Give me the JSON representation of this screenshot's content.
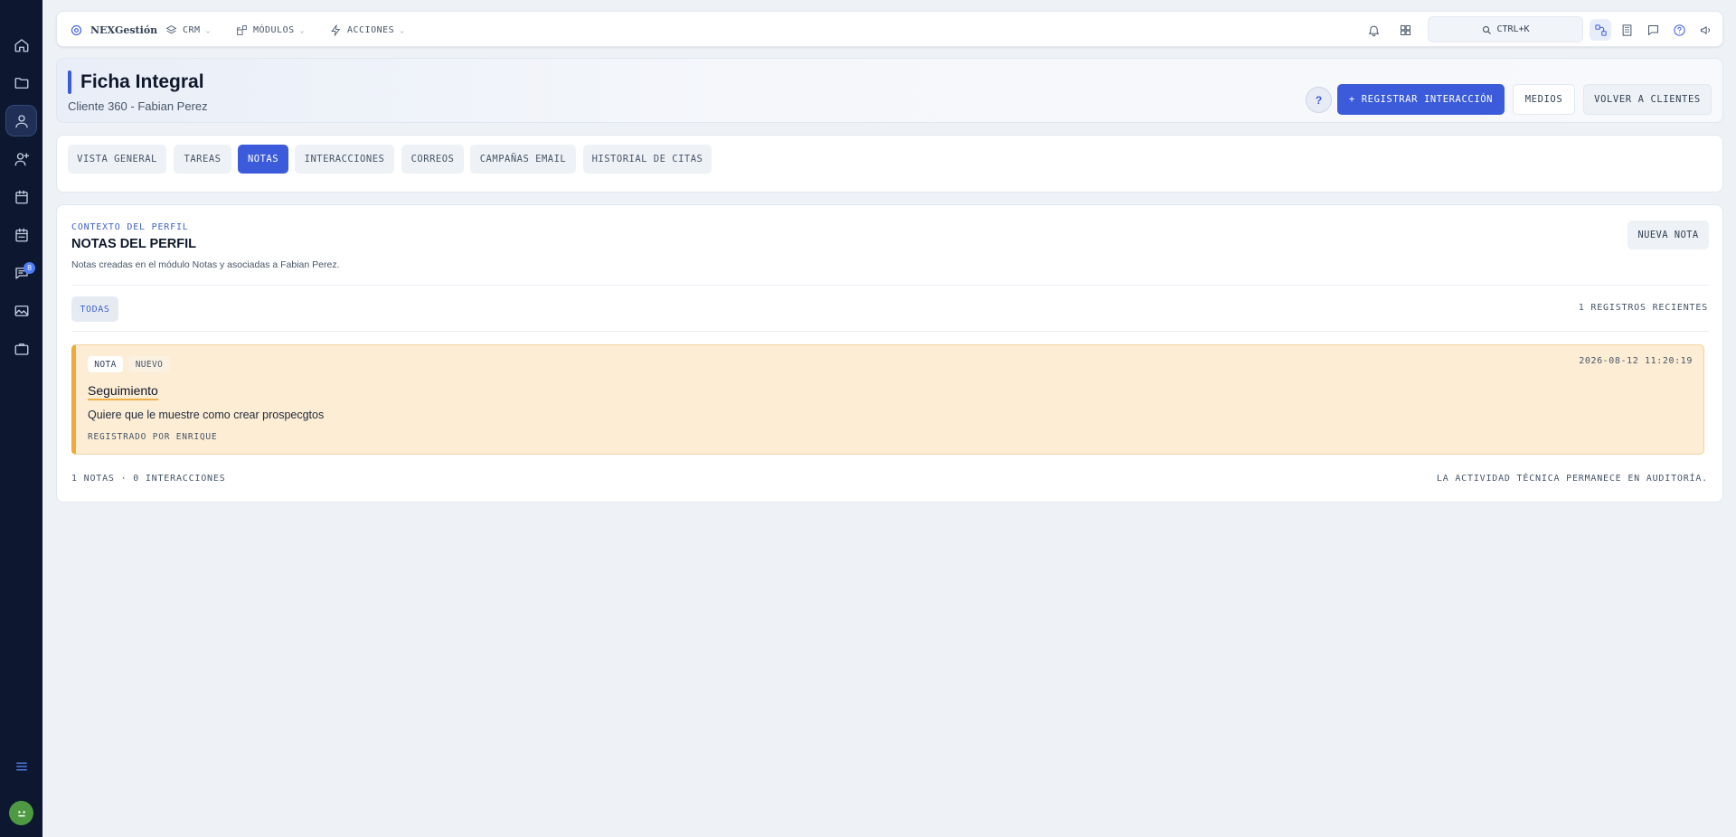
{
  "brand": {
    "name": "NEXGestión"
  },
  "topnav": {
    "items": [
      {
        "label": "CRM",
        "icon": "layers-icon"
      },
      {
        "label": "MÓDULOS",
        "icon": "modules-icon"
      },
      {
        "label": "ACCIONES",
        "icon": "bolt-icon"
      }
    ],
    "search_label": "CTRL+K"
  },
  "sidebar": {
    "items": [
      {
        "icon": "home-icon"
      },
      {
        "icon": "folder-icon"
      },
      {
        "icon": "user-icon",
        "active": true
      },
      {
        "icon": "user-plus-icon"
      },
      {
        "icon": "calendar-icon"
      },
      {
        "icon": "calendar-check-icon"
      },
      {
        "icon": "chat-icon",
        "badge": "8"
      },
      {
        "icon": "image-icon"
      },
      {
        "icon": "briefcase-icon"
      }
    ]
  },
  "header": {
    "title": "Ficha Integral",
    "subtitle": "Cliente 360 - Fabian Perez",
    "help_label": "?",
    "primary_button": "+ REGISTRAR INTERACCIÓN",
    "media_button": "MEDIOS",
    "back_button": "VOLVER A CLIENTES"
  },
  "tabs": [
    {
      "label": "VISTA GENERAL"
    },
    {
      "label": "TAREAS"
    },
    {
      "label": "NOTAS",
      "active": true
    },
    {
      "label": "INTERACCIONES"
    },
    {
      "label": "CORREOS"
    },
    {
      "label": "CAMPAÑAS EMAIL"
    },
    {
      "label": "HISTORIAL DE CITAS"
    }
  ],
  "notes_section": {
    "eyebrow": "CONTEXTO DEL PERFIL",
    "title": "NOTAS DEL PERFIL",
    "description": "Notas creadas en el módulo Notas y asociadas a Fabian Perez.",
    "new_button": "NUEVA NOTA",
    "filter": "TODAS",
    "count": "1 REGISTROS RECIENTES",
    "notes": [
      {
        "tag": "NOTA",
        "status": "NUEVO",
        "date": "2026-08-12 11:20:19",
        "title": "Seguimiento",
        "body": "Quiere que le muestre como crear prospecgtos",
        "author": "REGISTRADO POR ENRIQUE"
      }
    ],
    "footer_left": "1 NOTAS · 0 INTERACCIONES",
    "footer_right": "LA ACTIVIDAD TÉCNICA PERMANECE EN AUDITORÍA."
  },
  "colors": {
    "sidebar_bg": "#0d1730",
    "accent": "#3b5bdb",
    "note_bg": "#fdedd4",
    "note_border": "#f0a93a"
  }
}
